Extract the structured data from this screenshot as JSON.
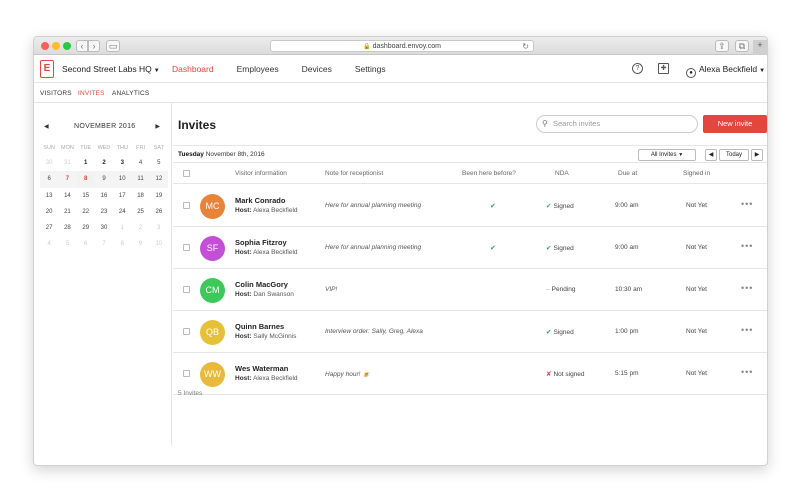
{
  "browser": {
    "url": "dashboard.envoy.com"
  },
  "header": {
    "logo_letter": "E",
    "company": "Second Street Labs HQ",
    "nav": [
      "Dashboard",
      "Employees",
      "Devices",
      "Settings"
    ],
    "active_nav": "Dashboard",
    "user": "Alexa Beckfield"
  },
  "subnav": {
    "items": [
      "VISITORS",
      "INVITES",
      "ANALYTICS"
    ],
    "active": "INVITES"
  },
  "calendar": {
    "month": "NOVEMBER 2016",
    "days_of_week": [
      "SUN",
      "MON",
      "TUE",
      "WED",
      "THU",
      "FRI",
      "SAT"
    ],
    "weeks": [
      [
        "30",
        "31",
        "1",
        "2",
        "3",
        "4",
        "5"
      ],
      [
        "6",
        "7",
        "8",
        "9",
        "10",
        "11",
        "12"
      ],
      [
        "13",
        "14",
        "15",
        "16",
        "17",
        "18",
        "19"
      ],
      [
        "20",
        "21",
        "22",
        "23",
        "24",
        "25",
        "26"
      ],
      [
        "27",
        "28",
        "29",
        "30",
        "1",
        "2",
        "3"
      ],
      [
        "4",
        "5",
        "6",
        "7",
        "8",
        "9",
        "10"
      ]
    ]
  },
  "main": {
    "title": "Invites",
    "search_placeholder": "Search invites",
    "new_invite": "New invite",
    "date_day": "Tuesday",
    "date_rest": "November 8th, 2016",
    "filter": "All Invites",
    "today": "Today",
    "columns": [
      "Visitor information",
      "Note for receptionist",
      "Been here before?",
      "NDA",
      "Due at",
      "Signed in"
    ],
    "host_label": "Host:",
    "count": "5 Invites"
  },
  "rows": [
    {
      "initials": "MC",
      "color": "#e8833a",
      "name": "Mark Conrado",
      "host": "Alexa Beckfield",
      "note": "Here for annual planning meeting",
      "been": "✔",
      "nda_mark": "✔",
      "nda": "Signed",
      "due": "9:00 am",
      "signed": "Not Yet"
    },
    {
      "initials": "SF",
      "color": "#c24fd6",
      "name": "Sophia Fitzroy",
      "host": "Alexa Beckfield",
      "note": "Here for annual planning meeting",
      "been": "✔",
      "nda_mark": "✔",
      "nda": "Signed",
      "due": "9:00 am",
      "signed": "Not Yet"
    },
    {
      "initials": "CM",
      "color": "#3ec85a",
      "name": "Colin MacGory",
      "host": "Dan Swanson",
      "note": "VIP!",
      "been": "",
      "nda_mark": "–",
      "nda": "Pending",
      "due": "10:30 am",
      "signed": "Not Yet"
    },
    {
      "initials": "QB",
      "color": "#e6c038",
      "name": "Quinn Barnes",
      "host": "Sally McGinnis",
      "note": "Interview order: Sally, Greg, Alexa",
      "been": "",
      "nda_mark": "✔",
      "nda": "Signed",
      "due": "1:00 pm",
      "signed": "Not Yet"
    },
    {
      "initials": "WW",
      "color": "#e8b93a",
      "name": "Wes Waterman",
      "host": "Alexa Beckfield",
      "note": "Happy hour! 🍺",
      "been": "",
      "nda_mark": "✘",
      "nda": "Not signed",
      "due": "5:15 pm",
      "signed": "Not Yet"
    }
  ]
}
